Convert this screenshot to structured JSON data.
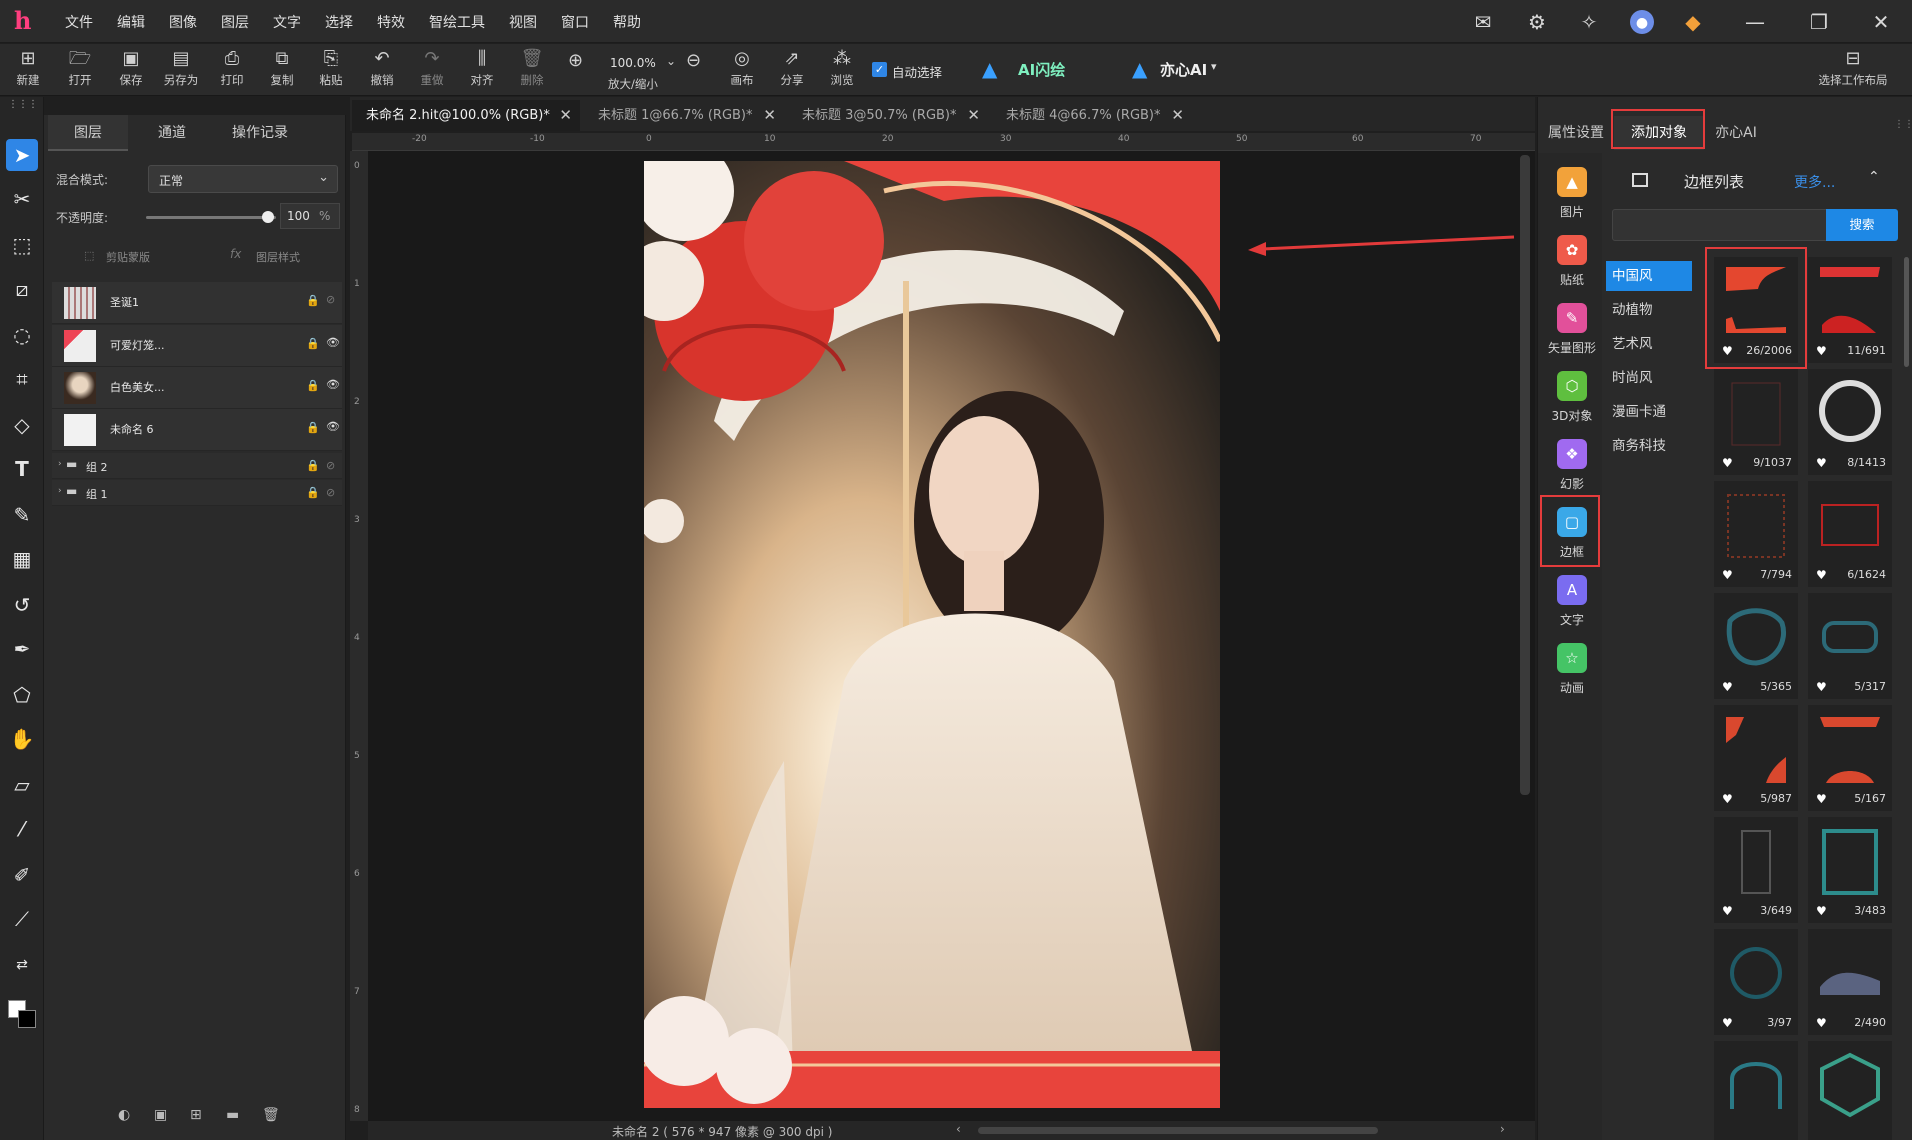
{
  "menubar": {
    "logo": "h",
    "items": [
      "文件",
      "编辑",
      "图像",
      "图层",
      "文字",
      "选择",
      "特效",
      "智绘工具",
      "视图",
      "窗口",
      "帮助"
    ]
  },
  "toolbar": {
    "buttons": [
      {
        "label": "新建",
        "icon": "new-file-icon"
      },
      {
        "label": "打开",
        "icon": "folder-open-icon"
      },
      {
        "label": "保存",
        "icon": "save-icon"
      },
      {
        "label": "另存为",
        "icon": "save-as-icon"
      },
      {
        "label": "打印",
        "icon": "print-icon"
      },
      {
        "label": "复制",
        "icon": "copy-icon"
      },
      {
        "label": "粘贴",
        "icon": "paste-icon"
      },
      {
        "label": "撤销",
        "icon": "undo-icon"
      },
      {
        "label": "重做",
        "icon": "redo-icon"
      },
      {
        "label": "对齐",
        "icon": "align-icon"
      },
      {
        "label": "删除",
        "icon": "delete-icon"
      }
    ],
    "zoom_value": "100.0%",
    "zoom_label": "放大/缩小",
    "canvas_label": "画布",
    "share_label": "分享",
    "browse_label": "浏览",
    "auto_select_label": "自动选择",
    "auto_select_checked": true,
    "ai_flash_label": "AI闪绘",
    "yixin_label": "亦心AI",
    "workspace_label": "选择工作布局"
  },
  "layers_panel": {
    "tabs": [
      "图层",
      "通道",
      "操作记录"
    ],
    "blend_label": "混合模式:",
    "blend_value": "正常",
    "opacity_label": "不透明度:",
    "opacity_value": "100",
    "opacity_unit": "%",
    "opacity_fraction": 1.0,
    "clip_label": "剪贴蒙版",
    "style_label": "图层样式",
    "layers": [
      {
        "name": "圣诞1",
        "visible": true
      },
      {
        "name": "可爱灯笼...",
        "visible": true
      },
      {
        "name": "白色美女...",
        "visible": true
      },
      {
        "name": "未命名 6",
        "visible": true
      }
    ],
    "groups": [
      {
        "name": "组 2"
      },
      {
        "name": "组 1"
      }
    ]
  },
  "document_tabs": [
    {
      "title": "未命名 2.hit@100.0% (RGB)*",
      "active": true
    },
    {
      "title": "未标题 1@66.7% (RGB)*",
      "active": false
    },
    {
      "title": "未标题 3@50.7% (RGB)*",
      "active": false
    },
    {
      "title": "未标题 4@66.7% (RGB)*",
      "active": false
    }
  ],
  "ruler_top_labels": [
    "-20",
    "-10",
    "0",
    "10",
    "20",
    "30",
    "40",
    "50",
    "60",
    "70"
  ],
  "ruler_left_labels": [
    "0",
    "1",
    "2",
    "3",
    "4",
    "5",
    "6",
    "7",
    "8"
  ],
  "status": "未命名 2 ( 576 * 947 像素 @ 300 dpi )",
  "right_panel": {
    "tabs": [
      "属性设置",
      "添加对象",
      "亦心AI"
    ],
    "categories": [
      {
        "label": "图片",
        "color": "#f2a23a"
      },
      {
        "label": "贴纸",
        "color": "#ef5a4a"
      },
      {
        "label": "矢量图形",
        "color": "#e2509a"
      },
      {
        "label": "3D对象",
        "color": "#5fbf3f"
      },
      {
        "label": "幻影",
        "color": "#a06af0"
      },
      {
        "label": "边框",
        "color": "#3aa8e8"
      },
      {
        "label": "文字",
        "color": "#7a6cf0"
      },
      {
        "label": "动画",
        "color": "#45c466"
      }
    ],
    "list_title": "边框列表",
    "more_label": "更多...",
    "search_button": "搜索",
    "search_value": "",
    "subcategories": [
      "中国风",
      "动植物",
      "艺术风",
      "时尚风",
      "漫画卡通",
      "商务科技"
    ],
    "thumbs": [
      "26/2006",
      "11/691",
      "9/1037",
      "8/1413",
      "7/794",
      "6/1624",
      "5/365",
      "5/317",
      "5/987",
      "5/167",
      "3/649",
      "3/483",
      "3/97",
      "2/490",
      "",
      ""
    ]
  },
  "colors": {
    "accent": "#1e88e5",
    "highlight": "#e43c3c",
    "panel": "#2a2a2a"
  }
}
